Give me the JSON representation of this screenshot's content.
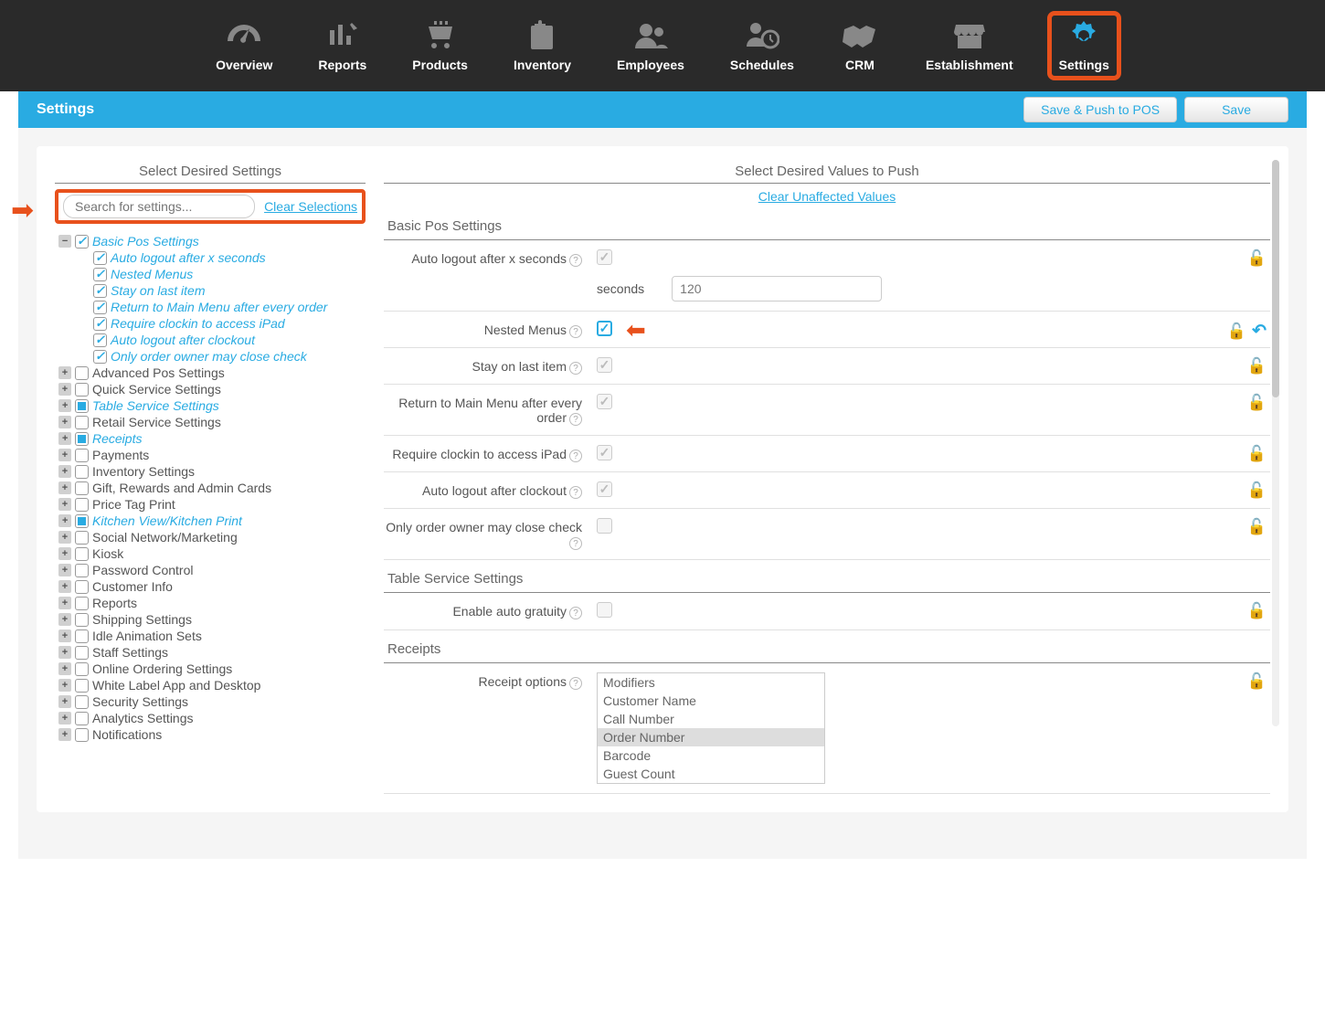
{
  "nav": {
    "items": [
      {
        "label": "Overview"
      },
      {
        "label": "Reports"
      },
      {
        "label": "Products"
      },
      {
        "label": "Inventory"
      },
      {
        "label": "Employees"
      },
      {
        "label": "Schedules"
      },
      {
        "label": "CRM"
      },
      {
        "label": "Establishment"
      },
      {
        "label": "Settings"
      }
    ]
  },
  "bluebar": {
    "title": "Settings",
    "save_push": "Save & Push to POS",
    "save": "Save"
  },
  "left": {
    "header": "Select Desired Settings",
    "search_placeholder": "Search for settings...",
    "clear": "Clear Selections",
    "tree": {
      "basic": {
        "label": "Basic Pos Settings",
        "items": [
          "Auto logout after x seconds",
          "Nested Menus",
          "Stay on last item",
          "Return to Main Menu after every order",
          "Require clockin to access iPad",
          "Auto logout after clockout",
          "Only order owner may close check"
        ]
      },
      "rest": [
        {
          "label": "Advanced Pos Settings",
          "state": "none"
        },
        {
          "label": "Quick Service Settings",
          "state": "none"
        },
        {
          "label": "Table Service Settings",
          "state": "partial"
        },
        {
          "label": "Retail Service Settings",
          "state": "none"
        },
        {
          "label": "Receipts",
          "state": "partial"
        },
        {
          "label": "Payments",
          "state": "none"
        },
        {
          "label": "Inventory Settings",
          "state": "none"
        },
        {
          "label": "Gift, Rewards and Admin Cards",
          "state": "none"
        },
        {
          "label": "Price Tag Print",
          "state": "none"
        },
        {
          "label": "Kitchen View/Kitchen Print",
          "state": "partial"
        },
        {
          "label": "Social Network/Marketing",
          "state": "none"
        },
        {
          "label": "Kiosk",
          "state": "none"
        },
        {
          "label": "Password Control",
          "state": "none"
        },
        {
          "label": "Customer Info",
          "state": "none"
        },
        {
          "label": "Reports",
          "state": "none"
        },
        {
          "label": "Shipping Settings",
          "state": "none"
        },
        {
          "label": "Idle Animation Sets",
          "state": "none"
        },
        {
          "label": "Staff Settings",
          "state": "none"
        },
        {
          "label": "Online Ordering Settings",
          "state": "none"
        },
        {
          "label": "White Label App and Desktop",
          "state": "none"
        },
        {
          "label": "Security Settings",
          "state": "none"
        },
        {
          "label": "Analytics Settings",
          "state": "none"
        },
        {
          "label": "Notifications",
          "state": "none"
        }
      ]
    }
  },
  "right": {
    "header": "Select Desired Values to Push",
    "clear": "Clear Unaffected Values",
    "sections": {
      "basic": {
        "title": "Basic Pos Settings",
        "rows": {
          "auto_logout": {
            "label": "Auto logout after x seconds",
            "seconds_label": "seconds",
            "seconds_value": "120"
          },
          "nested": {
            "label": "Nested Menus"
          },
          "stay": {
            "label": "Stay on last item"
          },
          "return_main": {
            "label": "Return to Main Menu after every order"
          },
          "require_clockin": {
            "label": "Require clockin to access iPad"
          },
          "auto_logout_clockout": {
            "label": "Auto logout after clockout"
          },
          "only_owner": {
            "label": "Only order owner may close check"
          }
        }
      },
      "table": {
        "title": "Table Service Settings",
        "rows": {
          "auto_gratuity": {
            "label": "Enable auto gratuity"
          }
        }
      },
      "receipts": {
        "title": "Receipts",
        "rows": {
          "options": {
            "label": "Receipt options",
            "items": [
              "Modifiers",
              "Customer Name",
              "Call Number",
              "Order Number",
              "Barcode",
              "Guest Count"
            ],
            "selected": "Order Number"
          }
        }
      }
    }
  }
}
